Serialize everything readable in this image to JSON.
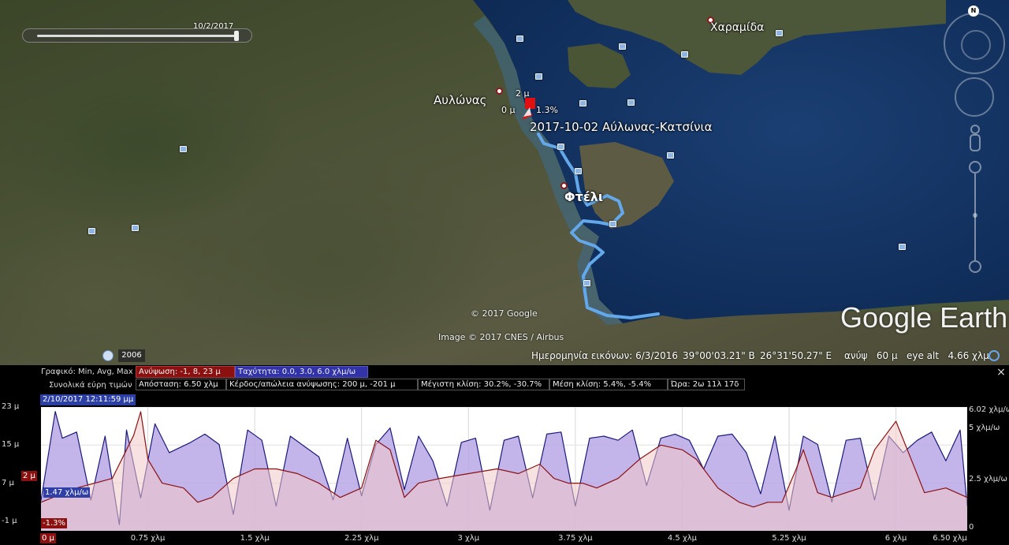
{
  "map": {
    "time_slider_date": "10/2/2017",
    "places": [
      {
        "id": "charamida",
        "label": "Χαραμίδα"
      },
      {
        "id": "avlonas",
        "label": "Αυλώνας"
      },
      {
        "id": "fteli",
        "label": "Φτέλι"
      }
    ],
    "track_label": "2017-10-02 Αύλωνας-Κατσίνια",
    "track_start_elev_top": "2 μ",
    "track_start_elev_left": "0 μ",
    "track_start_grade": "1.3%",
    "north_label": "N",
    "logo": "Google Earth",
    "copyright": "© 2017 Google",
    "imagery_credit": "Image © 2017 CNES / Airbus",
    "historical_year": "2006"
  },
  "status_bar": {
    "imagery_date": "Ημερομηνία εικόνων: 6/3/2016",
    "latitude": "39°00'03.21\" Β",
    "longitude": "26°31'50.27\" Ε",
    "elevation": "ανύψ   60 μ",
    "eye_alt": "eye alt   4.66 χλμ"
  },
  "profile": {
    "graph_label": "Γραφικό: Min, Avg, Max",
    "elevation_field": "Ανύψωση: -1, 8, 23 μ",
    "speed_field": "Ταχύτητα: 0.0, 3.0, 6.0 χλμ/ω",
    "totals_label": "Συνολικά εύρη τιμών",
    "distance_field": "Απόσταση: 6.50 χλμ",
    "gain_loss_field": "Κέρδος/απώλεια ανύψωσης: 200 μ, -201 μ",
    "max_slope_field": "Μέγιστη κλίση: 30.2%, -30.7%",
    "avg_slope_field": "Μέση κλίση: 5.4%, -5.4%",
    "time_field": "Ώρα: 2ω 11λ 17δ",
    "cursor_time": "2/10/2017 12:11:59 μμ",
    "cursor_elevation": "2 μ",
    "cursor_speed": "1.47 χλμ/ω",
    "cursor_grade": "-1.3%",
    "cursor_distance": "0 μ",
    "close_label": "×"
  },
  "chart_data": {
    "type": "line",
    "title": "",
    "xlabel": "",
    "ylabel": "",
    "xlim": [
      0,
      6.5
    ],
    "x_unit": "χλμ",
    "x_ticks": [
      {
        "value": 0.75,
        "label": "0.75 χλμ"
      },
      {
        "value": 1.5,
        "label": "1.5 χλμ"
      },
      {
        "value": 2.25,
        "label": "2.25 χλμ"
      },
      {
        "value": 3,
        "label": "3 χλμ"
      },
      {
        "value": 3.75,
        "label": "3.75 χλμ"
      },
      {
        "value": 4.5,
        "label": "4.5 χλμ"
      },
      {
        "value": 5.25,
        "label": "5.25 χλμ"
      },
      {
        "value": 6,
        "label": "6 χλμ"
      },
      {
        "value": 6.5,
        "label": "6.50 χλμ"
      }
    ],
    "y_left": {
      "lim": [
        -3,
        23
      ],
      "ticks": [
        {
          "value": 23,
          "label": "23 μ"
        },
        {
          "value": 15,
          "label": "15 μ"
        },
        {
          "value": 7,
          "label": "7 μ"
        },
        {
          "value": -1,
          "label": "-1 μ"
        }
      ]
    },
    "y_right": {
      "lim": [
        0,
        6.02
      ],
      "ticks": [
        {
          "value": 6.02,
          "label": "6.02 χλμ/ω"
        },
        {
          "value": 5,
          "label": "5 χλμ/ω"
        },
        {
          "value": 2.5,
          "label": "2.5 χλμ/ω"
        },
        {
          "value": 0,
          "label": "0"
        }
      ]
    },
    "grid": true,
    "series": [
      {
        "axis": "left",
        "color": "#8b1111",
        "fill": "#f3c8c8",
        "x": [
          0,
          0.25,
          0.5,
          0.65,
          0.7,
          0.75,
          0.85,
          1.0,
          1.1,
          1.2,
          1.35,
          1.5,
          1.65,
          1.8,
          1.95,
          2.1,
          2.25,
          2.35,
          2.45,
          2.55,
          2.65,
          2.8,
          3.0,
          3.2,
          3.35,
          3.5,
          3.6,
          3.7,
          3.8,
          3.9,
          4.05,
          4.2,
          4.35,
          4.5,
          4.6,
          4.75,
          4.9,
          5.0,
          5.1,
          5.2,
          5.3,
          5.35,
          5.45,
          5.55,
          5.65,
          5.75,
          5.85,
          6.0,
          6.2,
          6.35,
          6.5
        ],
        "y": [
          3,
          6,
          8,
          17,
          22,
          12,
          7,
          6,
          3,
          4,
          8,
          10,
          10,
          9,
          7,
          4,
          6,
          16,
          14,
          4,
          7,
          8,
          9,
          10,
          9,
          11,
          8,
          7,
          7,
          6,
          8,
          12,
          15,
          14,
          12,
          6,
          3,
          2,
          3,
          3,
          10,
          14,
          5,
          4,
          5,
          6,
          14,
          20,
          5,
          6,
          4
        ]
      },
      {
        "axis": "right",
        "color": "#1a1a7a",
        "fill": "#b9a7e6",
        "x": [
          0,
          0.1,
          0.15,
          0.25,
          0.35,
          0.45,
          0.55,
          0.6,
          0.7,
          0.8,
          0.9,
          1.05,
          1.15,
          1.25,
          1.35,
          1.45,
          1.55,
          1.65,
          1.75,
          1.85,
          1.95,
          2.05,
          2.15,
          2.25,
          2.35,
          2.45,
          2.55,
          2.65,
          2.75,
          2.85,
          2.95,
          3.05,
          3.15,
          3.25,
          3.35,
          3.45,
          3.55,
          3.65,
          3.75,
          3.85,
          3.95,
          4.05,
          4.15,
          4.25,
          4.35,
          4.45,
          4.55,
          4.65,
          4.75,
          4.85,
          4.95,
          5.05,
          5.15,
          5.25,
          5.35,
          5.45,
          5.55,
          5.65,
          5.75,
          5.85,
          5.95,
          6.05,
          6.15,
          6.25,
          6.35,
          6.45,
          6.5
        ],
        "y": [
          1.47,
          5.8,
          4.5,
          4.8,
          1.5,
          4.6,
          0.3,
          4.9,
          1.6,
          5.2,
          3.8,
          4.3,
          4.7,
          4.2,
          0.8,
          4.9,
          4.4,
          1.2,
          4.6,
          4.1,
          3.6,
          1.5,
          4.5,
          1.7,
          4.2,
          5.0,
          2.0,
          4.6,
          3.4,
          1.2,
          4.3,
          4.5,
          1.0,
          4.4,
          4.6,
          1.6,
          4.7,
          4.8,
          1.2,
          4.5,
          4.6,
          4.4,
          4.9,
          2.2,
          4.5,
          4.7,
          4.4,
          3.0,
          4.6,
          4.7,
          3.8,
          1.8,
          4.6,
          1.0,
          4.6,
          4.2,
          1.4,
          4.4,
          4.5,
          1.5,
          4.6,
          3.8,
          4.4,
          4.8,
          3.4,
          4.9,
          1.2
        ]
      }
    ]
  }
}
